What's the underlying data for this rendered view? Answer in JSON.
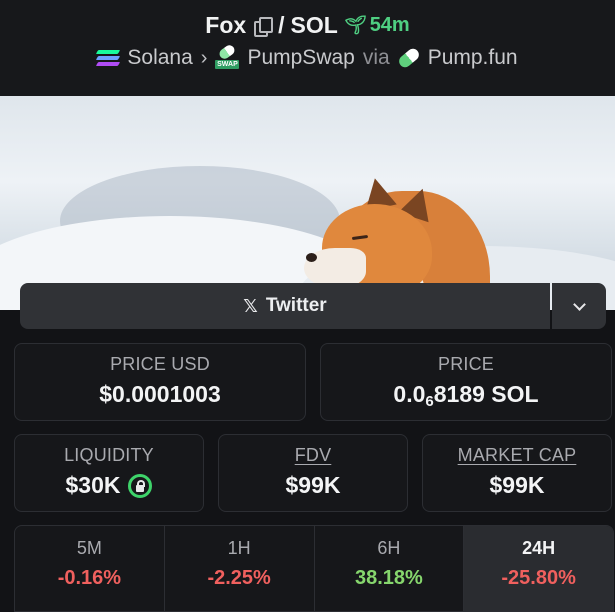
{
  "header": {
    "token": "Fox",
    "separator": "/",
    "quote": "SOL",
    "age": "54m",
    "chain": "Solana",
    "dex": "PumpSwap",
    "via_label": "via",
    "launchpad": "Pump.fun",
    "dex_badge": "SWAP",
    "icons": {
      "copy": "copy-icon",
      "age": "sprout-icon",
      "chain": "solana-icon",
      "dex": "pumpswap-icon",
      "launchpad": "pumpfun-pill-icon"
    },
    "age_color": "#4fcf82"
  },
  "banner": {
    "subject": "fox-in-snow-image"
  },
  "social": {
    "twitter_label": "Twitter",
    "icon": "x-logo-icon",
    "dropdown_icon": "chevron-down-icon"
  },
  "stats": {
    "price_usd": {
      "label": "PRICE USD",
      "value": "$0.0001003"
    },
    "price_native": {
      "label": "PRICE",
      "prefix": "0.0",
      "zeros": "6",
      "digits": "8189",
      "unit": "SOL"
    },
    "liquidity": {
      "label": "LIQUIDITY",
      "value": "$30K",
      "lock_icon": "lock-icon"
    },
    "fdv": {
      "label": "FDV",
      "value": "$99K"
    },
    "market_cap": {
      "label": "MARKET CAP",
      "value": "$99K"
    }
  },
  "timeframes": [
    {
      "key": "5M",
      "change": "-0.16%",
      "trend": "neg"
    },
    {
      "key": "1H",
      "change": "-2.25%",
      "trend": "neg"
    },
    {
      "key": "6H",
      "change": "38.18%",
      "trend": "pos"
    },
    {
      "key": "24H",
      "change": "-25.80%",
      "trend": "neg",
      "active": true
    }
  ],
  "colors": {
    "negative": "#f0605e",
    "positive": "#86d66d",
    "lock": "#3ed36a"
  }
}
